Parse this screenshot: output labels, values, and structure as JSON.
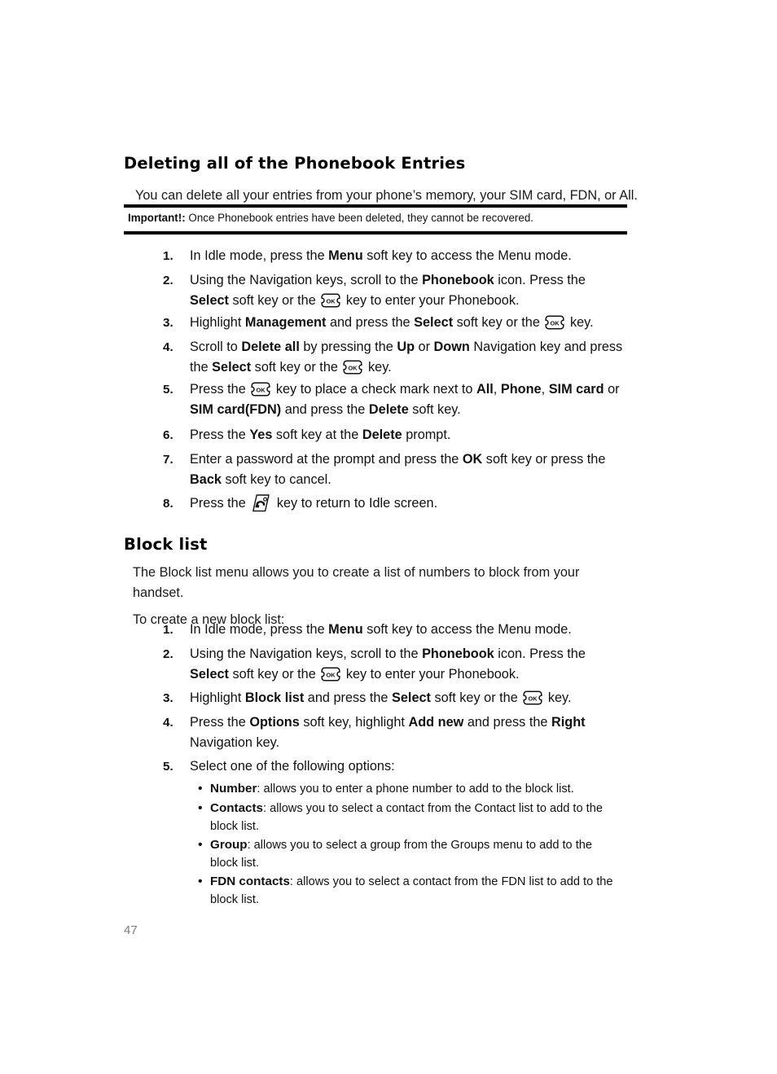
{
  "page": {
    "number": "47"
  },
  "section_delete": {
    "heading": "Deleting all of the Phonebook Entries",
    "intro": "You can delete all your entries from your phone’s memory, your SIM card, FDN, or All.",
    "important": {
      "label": "Important!:",
      "text": "Once Phonebook entries have been deleted, they cannot be recovered."
    },
    "steps": [
      {
        "num": "1.",
        "parts": [
          {
            "t": "In Idle mode, press the "
          },
          {
            "t": "Menu",
            "bold": true
          },
          {
            "t": " soft key to access the Menu mode."
          }
        ]
      },
      {
        "num": "2.",
        "parts": [
          {
            "t": "Using the Navigation keys, scroll to the "
          },
          {
            "t": "Phonebook",
            "bold": true
          },
          {
            "t": " icon. Press the "
          },
          {
            "t": "Select",
            "bold": true
          },
          {
            "t": " soft key or the "
          },
          {
            "icon": "ok-key"
          },
          {
            "t": " key to enter your Phonebook."
          }
        ]
      },
      {
        "num": "3.",
        "parts": [
          {
            "t": "Highlight "
          },
          {
            "t": "Management",
            "bold": true
          },
          {
            "t": " and press the "
          },
          {
            "t": "Select",
            "bold": true
          },
          {
            "t": " soft key or the "
          },
          {
            "icon": "ok-key"
          },
          {
            "t": " key."
          }
        ]
      },
      {
        "num": "4.",
        "parts": [
          {
            "t": "Scroll to "
          },
          {
            "t": "Delete all",
            "bold": true
          },
          {
            "t": " by pressing the "
          },
          {
            "t": "Up",
            "bold": true
          },
          {
            "t": " or "
          },
          {
            "t": "Down",
            "bold": true
          },
          {
            "t": " Navigation key and press the "
          },
          {
            "t": "Select",
            "bold": true
          },
          {
            "t": " soft key or the "
          },
          {
            "icon": "ok-key"
          },
          {
            "t": " key."
          }
        ]
      },
      {
        "num": "5.",
        "parts": [
          {
            "t": "Press the "
          },
          {
            "icon": "ok-key"
          },
          {
            "t": " key to place a check mark next to "
          },
          {
            "t": "All",
            "bold": true
          },
          {
            "t": ", "
          },
          {
            "t": "Phone",
            "bold": true
          },
          {
            "t": ", "
          },
          {
            "t": "SIM card",
            "bold": true
          },
          {
            "t": " or "
          },
          {
            "t": "SIM card(FDN)",
            "bold": true
          },
          {
            "t": " and press the "
          },
          {
            "t": "Delete",
            "bold": true
          },
          {
            "t": " soft key."
          }
        ]
      },
      {
        "num": "6.",
        "parts": [
          {
            "t": "Press the "
          },
          {
            "t": "Yes",
            "bold": true
          },
          {
            "t": " soft key at the "
          },
          {
            "t": "Delete",
            "bold": true
          },
          {
            "t": " prompt."
          }
        ]
      },
      {
        "num": "7.",
        "parts": [
          {
            "t": "Enter a password at the prompt and press the "
          },
          {
            "t": "OK",
            "bold": true
          },
          {
            "t": " soft key or press the "
          },
          {
            "t": "Back",
            "bold": true
          },
          {
            "t": " soft key to cancel."
          }
        ]
      },
      {
        "num": "8.",
        "parts": [
          {
            "t": "Press the "
          },
          {
            "icon": "end-call-key"
          },
          {
            "t": " key to return to Idle screen."
          }
        ]
      }
    ]
  },
  "section_blocklist": {
    "heading": "Block list",
    "description": "The Block list menu allows you to create a list of numbers to block from your handset.",
    "lead_in": "To create a new block list:",
    "steps": [
      {
        "num": "1.",
        "parts": [
          {
            "t": "In Idle mode, press the "
          },
          {
            "t": "Menu",
            "bold": true
          },
          {
            "t": " soft key to access the Menu mode."
          }
        ]
      },
      {
        "num": "2.",
        "parts": [
          {
            "t": "Using the Navigation keys, scroll to the "
          },
          {
            "t": "Phonebook",
            "bold": true
          },
          {
            "t": " icon. Press the "
          },
          {
            "t": "Select",
            "bold": true
          },
          {
            "t": " soft key or the "
          },
          {
            "icon": "ok-key"
          },
          {
            "t": " key to enter your Phonebook."
          }
        ]
      },
      {
        "num": "3.",
        "parts": [
          {
            "t": "Highlight "
          },
          {
            "t": "Block list",
            "bold": true
          },
          {
            "t": " and press the "
          },
          {
            "t": "Select",
            "bold": true
          },
          {
            "t": " soft key or the "
          },
          {
            "icon": "ok-key"
          },
          {
            "t": " key."
          }
        ]
      },
      {
        "num": "4.",
        "parts": [
          {
            "t": "Press the "
          },
          {
            "t": "Options",
            "bold": true
          },
          {
            "t": " soft key, highlight "
          },
          {
            "t": "Add new",
            "bold": true
          },
          {
            "t": " and press the "
          },
          {
            "t": "Right",
            "bold": true
          },
          {
            "t": " Navigation key."
          }
        ]
      },
      {
        "num": "5.",
        "parts": [
          {
            "t": "Select one of the following options:"
          }
        ]
      }
    ],
    "options": [
      {
        "bullet": "•",
        "term": "Number",
        "desc": ": allows you to enter a phone number to add to the block list."
      },
      {
        "bullet": "•",
        "term": "Contacts",
        "desc": ": allows you to select a contact from the Contact list to add to the block list."
      },
      {
        "bullet": "•",
        "term": "Group",
        "desc": ": allows you to select a group from the Groups menu to add to the block list."
      },
      {
        "bullet": "•",
        "term": "FDN contacts",
        "desc": ": allows you to select a contact from the FDN list to add to the block list."
      }
    ]
  },
  "icons": {
    "ok_key_label": "OK",
    "ok_key_name": "ok-key-icon",
    "end_call_key_name": "end-call-key-icon"
  },
  "colors": {
    "text": "#111111",
    "rule": "#000000",
    "page_number": "#7d7d7d",
    "background": "#ffffff"
  }
}
